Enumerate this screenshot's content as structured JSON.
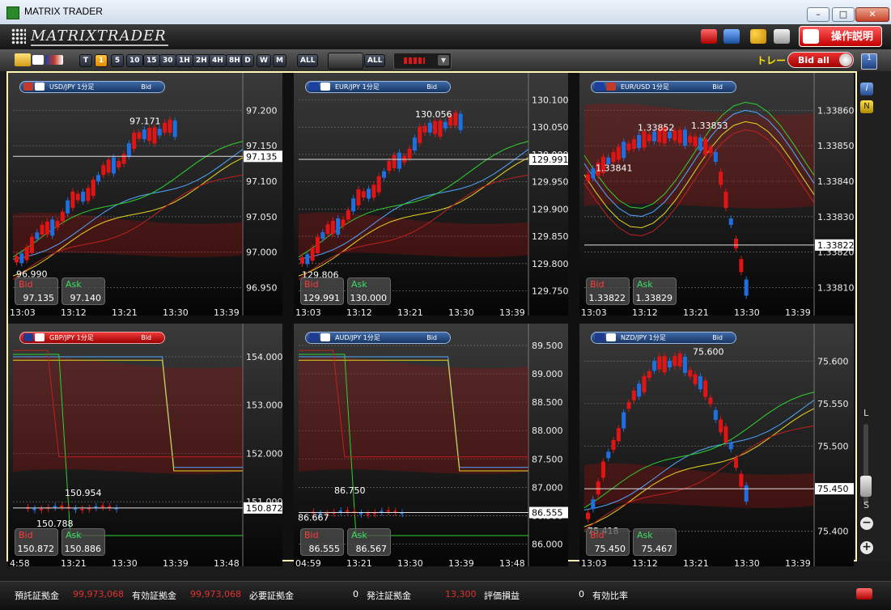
{
  "window": {
    "title": "MATRIX TRADER",
    "min": "–",
    "max": "□",
    "close": "✕"
  },
  "header": {
    "logo": "MATRIXTRADER",
    "manual_button": "操作説明"
  },
  "toolbar": {
    "timeframes": [
      "T",
      "1",
      "5",
      "10",
      "15",
      "30",
      "1H",
      "2H",
      "4H",
      "8H",
      "D",
      "W",
      "M"
    ],
    "active_timeframe": "1",
    "all_label": "ALL",
    "all_label2": "ALL",
    "trade_label": "トレード",
    "bid_toggle": "Bid all",
    "layout_num": "1"
  },
  "colors": {
    "bull": "#e01515",
    "bear": "#1f6fe0",
    "highlight": "#fff7b5",
    "bid": "#ff3a3a",
    "ask": "#38e060"
  },
  "panels": [
    {
      "pair": "USD/JPY",
      "title": "USD/JPY 1分足",
      "side": "Bid",
      "header_style": "blue",
      "flags": [
        "#c0392b",
        "#ffffff"
      ],
      "y_ticks": [
        "97.200",
        "97.150",
        "97.100",
        "97.050",
        "97.000",
        "96.950"
      ],
      "ymin": 96.93,
      "ymax": 97.23,
      "current_price": "97.135",
      "current_value": 97.135,
      "high_label": "97.171",
      "high_value": 97.171,
      "low_label": "96.990",
      "low_value": 96.99,
      "bid": "97.135",
      "ask": "97.140",
      "x_labels": [
        "13:03",
        "13:12",
        "13:21",
        "13:30",
        "13:39"
      ],
      "path": "up"
    },
    {
      "pair": "EUR/JPY",
      "title": "EUR/JPY 1分足",
      "side": "Bid",
      "header_style": "blue",
      "flags": [
        "#1a3fa0",
        "#ffffff"
      ],
      "y_ticks": [
        "130.100",
        "130.050",
        "130.000",
        "129.950",
        "129.900",
        "129.850",
        "129.800",
        "129.750"
      ],
      "ymin": 129.73,
      "ymax": 130.12,
      "current_price": "129.991",
      "current_value": 129.991,
      "high_label": "130.056",
      "high_value": 130.056,
      "low_label": "129.806",
      "low_value": 129.806,
      "bid": "129.991",
      "ask": "130.000",
      "x_labels": [
        "13:03",
        "13:12",
        "13:21",
        "13:30",
        "13:39"
      ],
      "path": "up"
    },
    {
      "pair": "EUR/USD",
      "title": "EUR/USD 1分足",
      "side": "Bid",
      "header_style": "blue",
      "flags": [
        "#1a3fa0",
        "#c0392b"
      ],
      "y_ticks": [
        "1.33860",
        "1.33850",
        "1.33840",
        "1.33830",
        "1.33820",
        "1.33810"
      ],
      "ymin": 1.33806,
      "ymax": 1.33866,
      "current_price": "1.33822",
      "current_value": 1.33822,
      "high_label": "1.33853",
      "high_value": 1.33853,
      "high2_label": "1.33852",
      "high2_value": 1.33852,
      "mid_label": "1.33841",
      "mid_value": 1.33841,
      "bid": "1.33822",
      "ask": "1.33829",
      "x_labels": [
        "13:03",
        "13:12",
        "13:21",
        "13:30",
        "13:39"
      ],
      "path": "down"
    },
    {
      "pair": "GBP/JPY",
      "title": "GBP/JPY 1分足",
      "side": "Bid",
      "header_style": "red",
      "flags": [
        "#213a8f",
        "#ffffff"
      ],
      "y_ticks": [
        "154.000",
        "153.000",
        "152.000",
        "151.000"
      ],
      "ymin": 149.95,
      "ymax": 154.35,
      "current_price": "150.872",
      "current_value": 150.872,
      "high_label": "150.954",
      "high_value": 150.954,
      "low_label": "150.788",
      "low_value": 150.788,
      "bid": "150.872",
      "ask": "150.886",
      "x_labels": [
        "4:58",
        "13:21",
        "13:30",
        "13:39",
        "13:48"
      ],
      "path": "flat"
    },
    {
      "pair": "AUD/JPY",
      "title": "AUD/JPY 1分足",
      "side": "Bid",
      "header_style": "blue",
      "flags": [
        "#213a8f",
        "#ffffff"
      ],
      "y_ticks": [
        "89.500",
        "89.000",
        "88.500",
        "88.000",
        "87.500",
        "87.000",
        "86.500",
        "86.000"
      ],
      "ymin": 85.85,
      "ymax": 89.6,
      "current_price": "86.555",
      "current_value": 86.555,
      "high_label": "86.750",
      "high_value": 86.75,
      "low_label": "86.667",
      "low_value": 86.667,
      "bid": "86.555",
      "ask": "86.567",
      "x_labels": [
        "04:59",
        "13:21",
        "13:30",
        "13:39",
        "13:48"
      ],
      "path": "flat"
    },
    {
      "pair": "NZD/JPY",
      "title": "NZD/JPY 1分足",
      "side": "Bid",
      "header_style": "blue",
      "flags": [
        "#213a8f",
        "#ffffff"
      ],
      "y_ticks": [
        "75.600",
        "75.550",
        "75.500",
        "75.450",
        "75.400"
      ],
      "ymin": 75.375,
      "ymax": 75.625,
      "current_price": "75.450",
      "current_value": 75.45,
      "high_label": "75.600",
      "high_value": 75.6,
      "low_label": "75.418",
      "low_value": 75.418,
      "bid": "75.450",
      "ask": "75.467",
      "x_labels": [
        "13:03",
        "13:12",
        "13:21",
        "13:30",
        "13:39"
      ],
      "path": "updown"
    }
  ],
  "footer": {
    "deposit_label": "預託証拠金",
    "deposit_value": "99,973,068",
    "effective_label": "有効証拠金",
    "effective_value": "99,973,068",
    "required_label": "必要証拠金",
    "required_value": "0",
    "order_label": "発注証拠金",
    "order_value": "13,300",
    "pl_label": "評価損益",
    "pl_value": "0",
    "ratio_label": "有効比率"
  },
  "side_strip": {
    "l": "L",
    "s": "S",
    "info": "i",
    "n": "N"
  }
}
